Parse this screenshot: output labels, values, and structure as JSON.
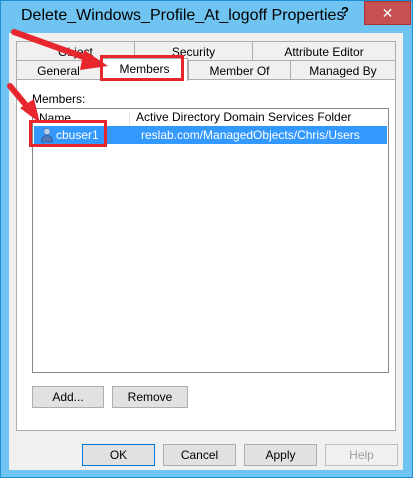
{
  "window": {
    "title": "Delete_Windows_Profile_At_logoff Properties",
    "help_label": "?",
    "close_label": "✕"
  },
  "tabs": {
    "row1": [
      {
        "label": "Object"
      },
      {
        "label": "Security"
      },
      {
        "label": "Attribute Editor"
      }
    ],
    "row2": [
      {
        "label": "General"
      },
      {
        "label": "Members"
      },
      {
        "label": "Member Of"
      },
      {
        "label": "Managed By"
      }
    ],
    "active": "Members"
  },
  "members": {
    "label": "Members:",
    "columns": [
      "Name",
      "Active Directory Domain Services Folder"
    ],
    "rows": [
      {
        "name": "cbuser1",
        "folder": "reslab.com/ManagedObjects/Chris/Users",
        "icon": "user-icon"
      }
    ]
  },
  "actions": {
    "add_label": "Add...",
    "remove_label": "Remove"
  },
  "footer": {
    "ok_label": "OK",
    "cancel_label": "Cancel",
    "apply_label": "Apply",
    "help_label": "Help"
  },
  "colors": {
    "titlebar": "#6fc4f2",
    "close": "#c75050",
    "selection": "#3399ff",
    "highlight": "#e8262d"
  }
}
